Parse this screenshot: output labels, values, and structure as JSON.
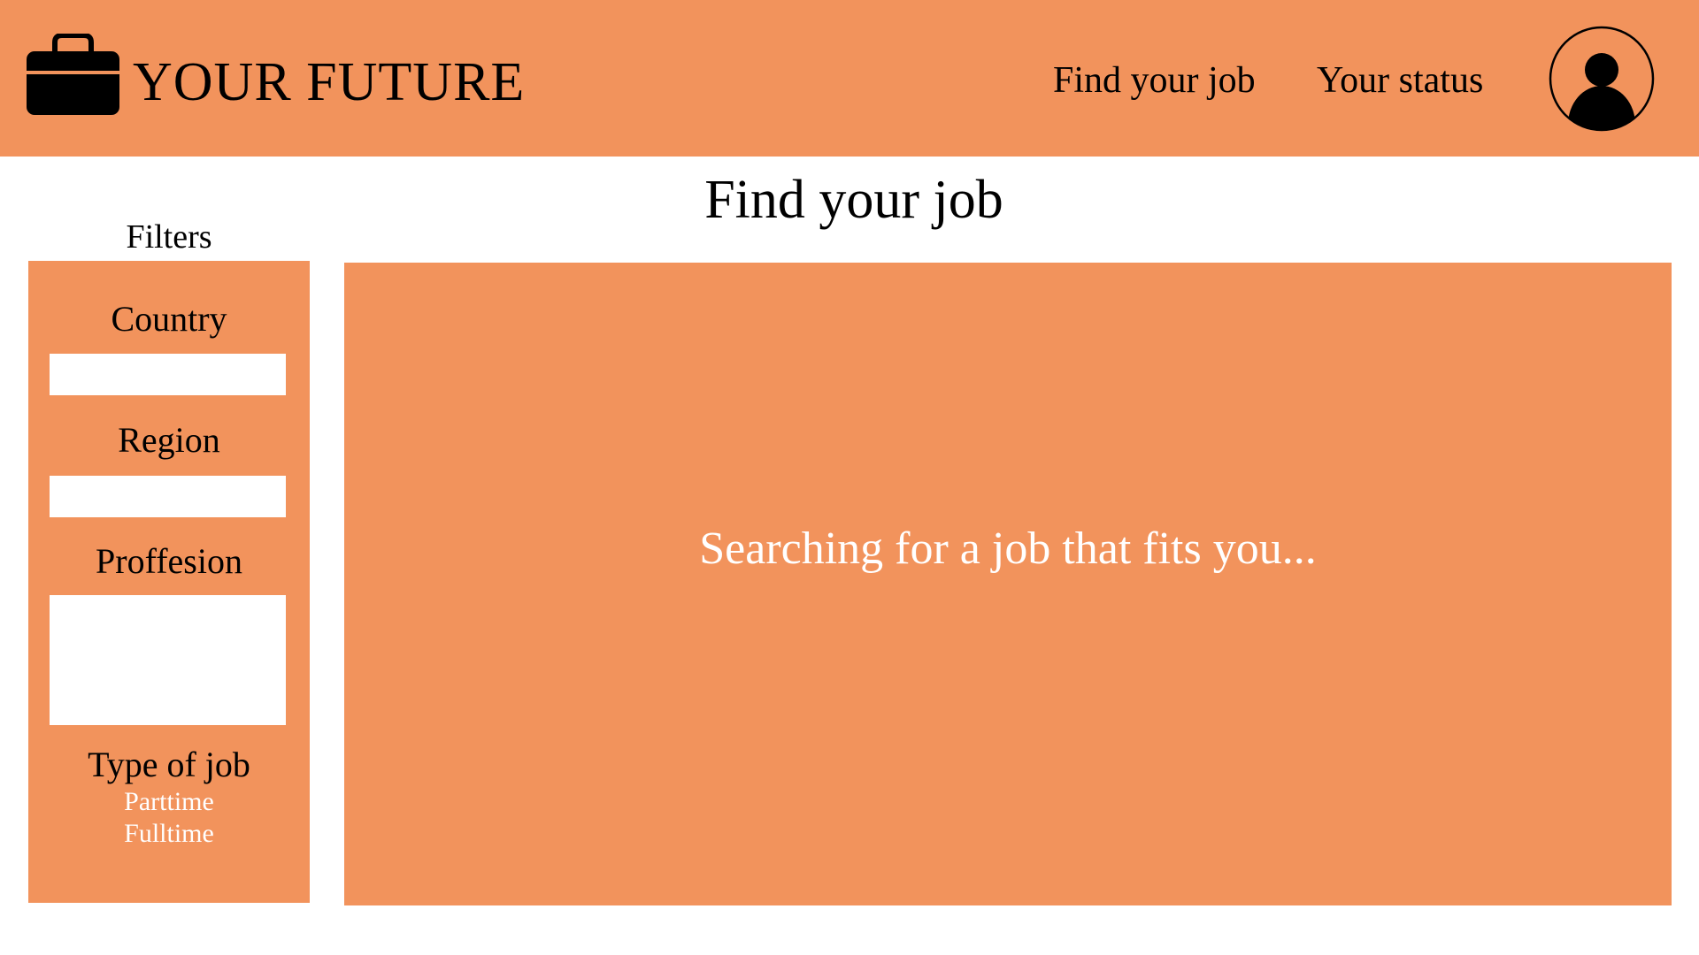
{
  "colors": {
    "accent": "#F2935C",
    "background": "#FFFFFF",
    "text": "#000000",
    "muted_text": "#FFFFFF"
  },
  "header": {
    "logo_icon": "briefcase-icon",
    "brand": "YOUR FUTURE",
    "nav": {
      "find_job": "Find your job",
      "status": "Your status"
    },
    "avatar_icon": "user-avatar-icon"
  },
  "page": {
    "title": "Find your job"
  },
  "filters": {
    "title": "Filters",
    "country": {
      "label": "Country",
      "value": ""
    },
    "region": {
      "label": "Region",
      "value": ""
    },
    "profession": {
      "label": "Proffesion",
      "value": ""
    },
    "job_type": {
      "label": "Type of job",
      "options": [
        "Parttime",
        "Fulltime"
      ]
    }
  },
  "results": {
    "status_text": "Searching for a job that fits you..."
  }
}
